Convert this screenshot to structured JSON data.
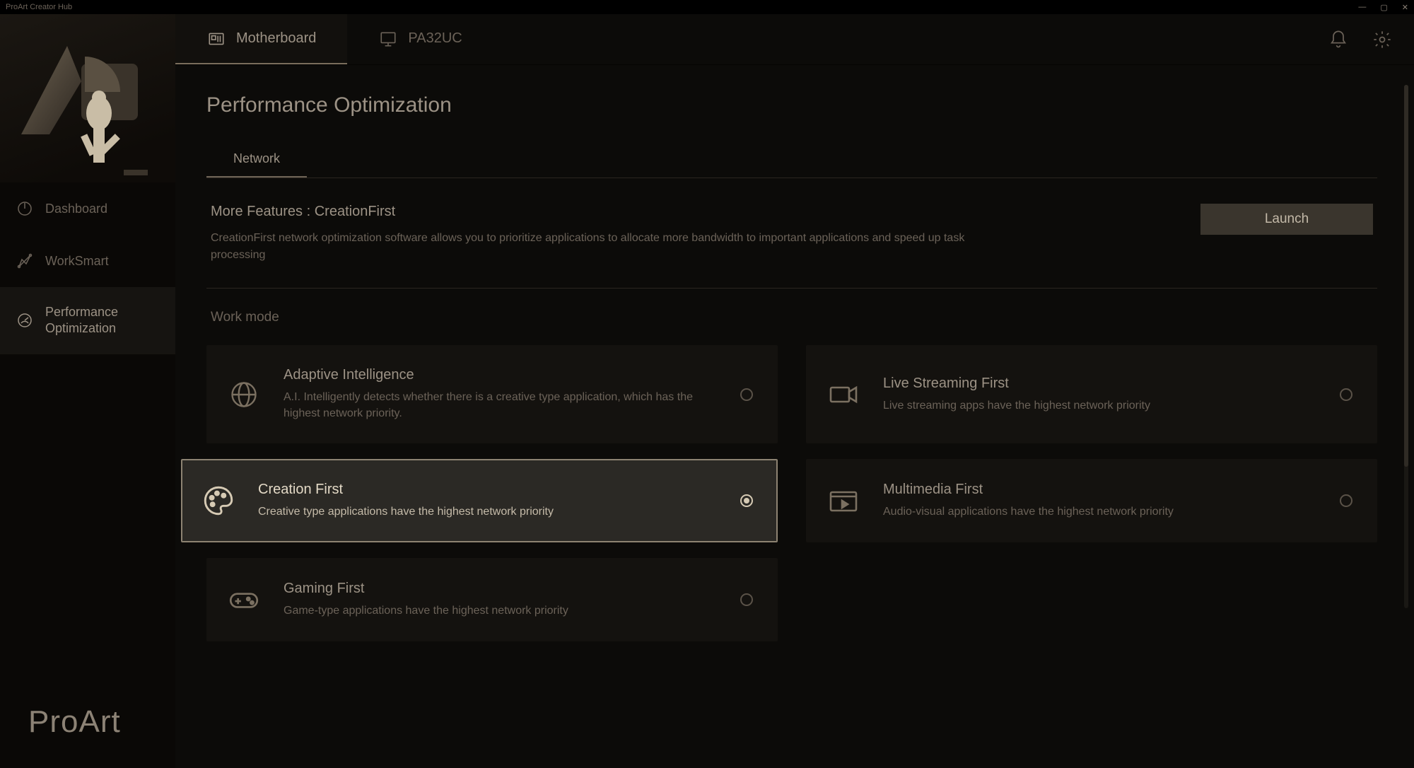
{
  "app": {
    "title": "ProArt Creator Hub",
    "brand": "ProArt"
  },
  "device_tabs": [
    {
      "label": "Motherboard",
      "active": true
    },
    {
      "label": "PA32UC",
      "active": false
    }
  ],
  "sidebar": {
    "items": [
      {
        "label": "Dashboard"
      },
      {
        "label": "WorkSmart"
      },
      {
        "label": "Performance Optimization"
      }
    ],
    "active_index": 2
  },
  "page": {
    "title": "Performance Optimization"
  },
  "sub_tabs": [
    {
      "label": "Network",
      "active": true
    }
  ],
  "feature": {
    "title": "More Features : CreationFirst",
    "desc": "CreationFirst network optimization software allows you to prioritize applications to allocate more bandwidth to important applications and speed up task processing",
    "cta": "Launch"
  },
  "section": {
    "work_mode_label": "Work mode"
  },
  "modes": [
    {
      "title": "Adaptive Intelligence",
      "desc": "A.I. Intelligently detects whether there is a creative type application, which has the highest network priority."
    },
    {
      "title": "Live Streaming First",
      "desc": "Live streaming apps have the highest network priority"
    },
    {
      "title": "Creation First",
      "desc": "Creative type applications have the highest network priority"
    },
    {
      "title": "Multimedia First",
      "desc": "Audio-visual applications have the highest network priority"
    },
    {
      "title": "Gaming First",
      "desc": "Game-type applications have the highest network priority"
    }
  ],
  "selected_mode_index": 2
}
